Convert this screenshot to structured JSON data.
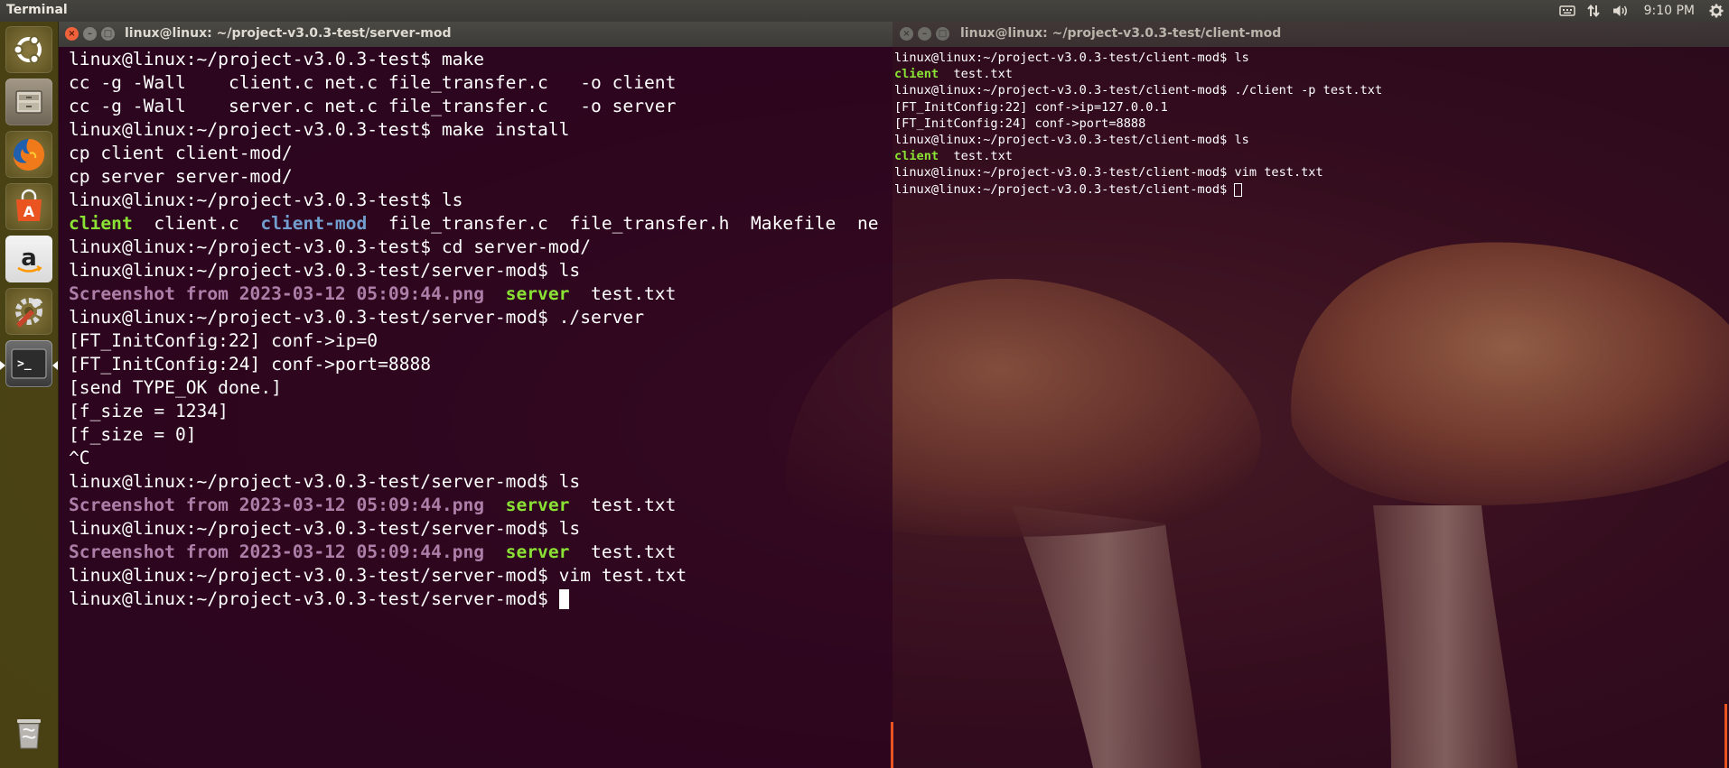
{
  "top_panel": {
    "app_title": "Terminal",
    "clock": "9:10 PM",
    "indicators": [
      "keyboard-icon",
      "network-arrows-icon",
      "volume-icon",
      "power-gear-icon"
    ]
  },
  "launcher": {
    "items": [
      {
        "name": "ubuntu-dash-icon",
        "color": "#e95420"
      },
      {
        "name": "files-icon",
        "color": "#7e7566"
      },
      {
        "name": "firefox-icon",
        "color": "#e66000"
      },
      {
        "name": "software-center-icon",
        "color": "#e95420"
      },
      {
        "name": "amazon-icon",
        "color": "#232f3e"
      },
      {
        "name": "system-settings-icon",
        "color": "#c7462b"
      },
      {
        "name": "terminal-icon",
        "color": "#2e2e2e"
      },
      {
        "name": "trash-icon",
        "color": "#9c9a96"
      }
    ]
  },
  "colors": {
    "green": "#8ae234",
    "blue": "#729fcf",
    "magenta": "#ad7fa8",
    "accent": "#e95420"
  },
  "term_left": {
    "title": "linux@linux: ~/project-v3.0.3-test/server-mod",
    "lines": [
      [
        {
          "t": "linux@linux:~/project-v3.0.3-test$ make"
        }
      ],
      [
        {
          "t": "cc -g -Wall    client.c net.c file_transfer.c   -o client"
        }
      ],
      [
        {
          "t": "cc -g -Wall    server.c net.c file_transfer.c   -o server"
        }
      ],
      [
        {
          "t": "linux@linux:~/project-v3.0.3-test$ make install"
        }
      ],
      [
        {
          "t": "cp client client-mod/"
        }
      ],
      [
        {
          "t": "cp server server-mod/"
        }
      ],
      [
        {
          "t": "linux@linux:~/project-v3.0.3-test$ ls"
        }
      ],
      [
        {
          "t": "client",
          "c": "g"
        },
        {
          "t": "  client.c  "
        },
        {
          "t": "client-mod",
          "c": "b"
        },
        {
          "t": "  file_transfer.c  file_transfer.h  Makefile  ne"
        }
      ],
      [
        {
          "t": "linux@linux:~/project-v3.0.3-test$ cd server-mod/"
        }
      ],
      [
        {
          "t": "linux@linux:~/project-v3.0.3-test/server-mod$ ls"
        }
      ],
      [
        {
          "t": "Screenshot from 2023-03-12 05:09:44.png",
          "c": "m"
        },
        {
          "t": "  "
        },
        {
          "t": "server",
          "c": "g"
        },
        {
          "t": "  test.txt"
        }
      ],
      [
        {
          "t": "linux@linux:~/project-v3.0.3-test/server-mod$ ./server"
        }
      ],
      [
        {
          "t": "[FT_InitConfig:22] conf->ip=0"
        }
      ],
      [
        {
          "t": "[FT_InitConfig:24] conf->port=8888"
        }
      ],
      [
        {
          "t": "[send TYPE_OK done.]"
        }
      ],
      [
        {
          "t": "[f_size = 1234]"
        }
      ],
      [
        {
          "t": "[f_size = 0]"
        }
      ],
      [
        {
          "t": "^C"
        }
      ],
      [
        {
          "t": "linux@linux:~/project-v3.0.3-test/server-mod$ ls"
        }
      ],
      [
        {
          "t": "Screenshot from 2023-03-12 05:09:44.png",
          "c": "m"
        },
        {
          "t": "  "
        },
        {
          "t": "server",
          "c": "g"
        },
        {
          "t": "  test.txt"
        }
      ],
      [
        {
          "t": "linux@linux:~/project-v3.0.3-test/server-mod$ ls"
        }
      ],
      [
        {
          "t": "Screenshot from 2023-03-12 05:09:44.png",
          "c": "m"
        },
        {
          "t": "  "
        },
        {
          "t": "server",
          "c": "g"
        },
        {
          "t": "  test.txt"
        }
      ],
      [
        {
          "t": "linux@linux:~/project-v3.0.3-test/server-mod$ vim test.txt"
        }
      ],
      [
        {
          "t": "linux@linux:~/project-v3.0.3-test/server-mod$ "
        },
        {
          "cursor": "block"
        }
      ]
    ]
  },
  "term_right": {
    "title": "linux@linux: ~/project-v3.0.3-test/client-mod",
    "lines": [
      [
        {
          "t": "linux@linux:~/project-v3.0.3-test/client-mod$ ls"
        }
      ],
      [
        {
          "t": "client",
          "c": "g"
        },
        {
          "t": "  test.txt"
        }
      ],
      [
        {
          "t": "linux@linux:~/project-v3.0.3-test/client-mod$ ./client -p test.txt"
        }
      ],
      [
        {
          "t": "[FT_InitConfig:22] conf->ip=127.0.0.1"
        }
      ],
      [
        {
          "t": "[FT_InitConfig:24] conf->port=8888"
        }
      ],
      [
        {
          "t": "linux@linux:~/project-v3.0.3-test/client-mod$ ls"
        }
      ],
      [
        {
          "t": "client",
          "c": "g"
        },
        {
          "t": "  test.txt"
        }
      ],
      [
        {
          "t": "linux@linux:~/project-v3.0.3-test/client-mod$ vim test.txt"
        }
      ],
      [
        {
          "t": "linux@linux:~/project-v3.0.3-test/client-mod$ "
        },
        {
          "cursor": "hollow"
        }
      ]
    ]
  }
}
